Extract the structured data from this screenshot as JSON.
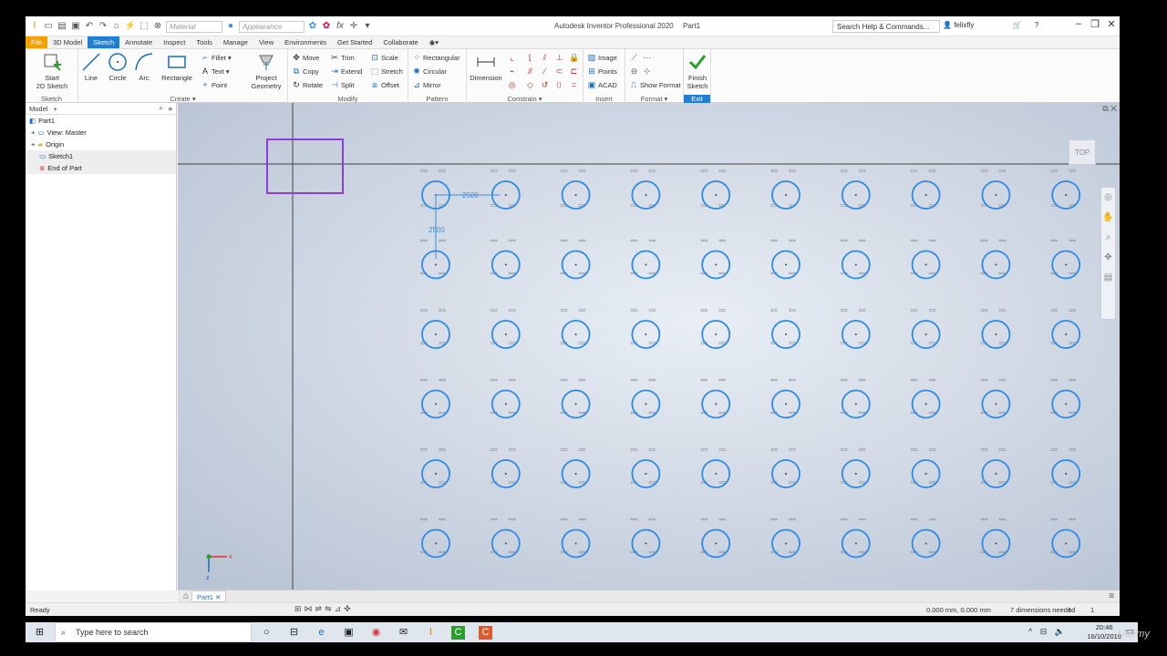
{
  "window": {
    "title": "Autodesk Inventor Professional 2020",
    "document": "Part1",
    "search_placeholder": "Search Help & Commands...",
    "user": "felixfly",
    "controls": [
      "–",
      "❐",
      "✕"
    ]
  },
  "qat": {
    "material": "Material",
    "appearance": "Appearance",
    "fx": "fx"
  },
  "tabs": [
    "File",
    "3D Model",
    "Sketch",
    "Annotate",
    "Inspect",
    "Tools",
    "Manage",
    "View",
    "Environments",
    "Get Started",
    "Collaborate"
  ],
  "active_tab": "Sketch",
  "ribbon": {
    "sketch": {
      "panel": "Sketch",
      "start_line1": "Start",
      "start_line2": "2D Sketch"
    },
    "create": {
      "panel": "Create",
      "line": "Line",
      "circle": "Circle",
      "arc": "Arc",
      "rectangle": "Rectangle",
      "fillet": "Fillet",
      "text": "Text",
      "point": "Point",
      "project_line1": "Project",
      "project_line2": "Geometry"
    },
    "modify": {
      "panel": "Modify",
      "move": "Move",
      "copy": "Copy",
      "rotate": "Rotate",
      "trim": "Trim",
      "extend": "Extend",
      "split": "Split",
      "scale": "Scale",
      "stretch": "Stretch",
      "offset": "Offset"
    },
    "pattern": {
      "panel": "Pattern",
      "rectangular": "Rectangular",
      "circular": "Circular",
      "mirror": "Mirror"
    },
    "constrain": {
      "panel": "Constrain",
      "dimension": "Dimension"
    },
    "insert": {
      "panel": "Insert",
      "image": "Image",
      "points": "Points",
      "acad": "ACAD"
    },
    "format": {
      "panel": "Format",
      "show_format": "Show Format"
    },
    "exit": {
      "panel": "Exit",
      "finish_line1": "Finish",
      "finish_line2": "Sketch"
    }
  },
  "browser": {
    "tab": "Model",
    "add": "+",
    "items": [
      {
        "label": "Part1",
        "icon": "part-icon"
      },
      {
        "label": "View: Master",
        "icon": "view-icon"
      },
      {
        "label": "Origin",
        "icon": "folder-icon"
      },
      {
        "label": "Sketch1",
        "icon": "sketch-icon"
      },
      {
        "label": "End of Part",
        "icon": "end-of-part-icon"
      }
    ]
  },
  "canvas": {
    "viewcube": "TOP",
    "dim_horizontal": "2500",
    "dim_vertical": "2500",
    "axis_x": "x",
    "axis_z": "z",
    "pattern_columns": 10,
    "pattern_rows": 6
  },
  "document_tab": "Part1",
  "status": {
    "left": "Ready",
    "coords": "0.000 mm, 0.000 mm",
    "dims_needed": "7 dimensions needed",
    "count1": "1",
    "count2": "1"
  },
  "taskbar": {
    "search": "Type here to search",
    "time": "20:46",
    "date": "16/10/2019"
  },
  "watermark": "Udemy"
}
